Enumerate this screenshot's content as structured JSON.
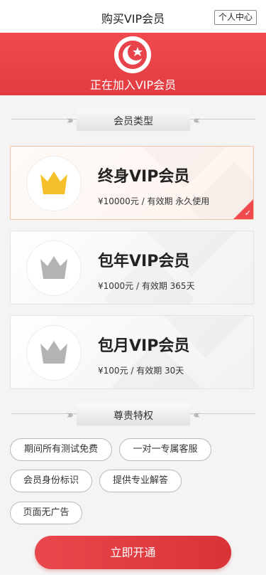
{
  "header": {
    "title": "购买VIP会员",
    "profile_button": "个人中心"
  },
  "banner": {
    "logo_icon": "vip-badge-icon",
    "text": "正在加入VIP会员",
    "color": "#e8434a"
  },
  "section_types": {
    "label": "会员类型"
  },
  "plans": [
    {
      "name": "终身VIP会员",
      "price": "¥10000元 / 有效期 永久使用",
      "selected": true,
      "crown_color": "#f5c02a"
    },
    {
      "name": "包年VIP会员",
      "price": "¥1000元 / 有效期 365天",
      "selected": false,
      "crown_color": "#b3b3b3"
    },
    {
      "name": "包月VIP会员",
      "price": "¥100元 / 有效期 30天",
      "selected": false,
      "crown_color": "#b3b3b3"
    }
  ],
  "section_privileges": {
    "label": "尊贵特权"
  },
  "privileges": [
    "期间所有测试免费",
    "一对一专属客服",
    "会员身份标识",
    "提供专业解答",
    "页面无广告"
  ],
  "cta": {
    "label": "立即开通"
  }
}
